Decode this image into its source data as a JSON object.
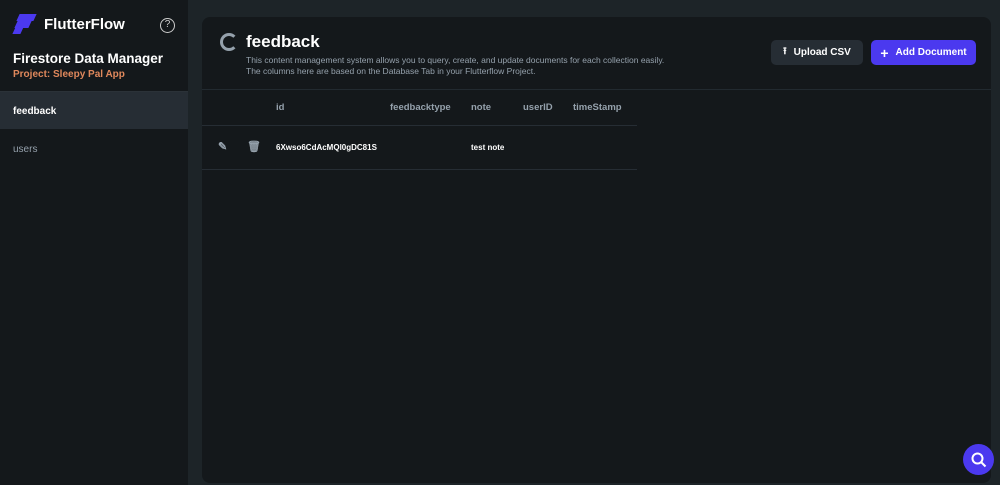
{
  "brand": "FlutterFlow",
  "help_icon": "?",
  "title": "Firestore Data Manager",
  "project": "Project: Sleepy Pal App",
  "collections": [
    {
      "label": "feedback"
    },
    {
      "label": "users"
    }
  ],
  "main": {
    "title": "feedback",
    "description": "This content management system allows you to query, create, and update documents for each collection easily. The columns here are based on the Database Tab in your Flutterflow Project.",
    "upload_label": "Upload CSV",
    "add_label": "Add Document"
  },
  "table": {
    "columns": [
      "id",
      "feedbacktype",
      "note",
      "userID",
      "timeStamp"
    ],
    "rows": [
      {
        "id": "6Xwso6CdAcMQl0gDC81S",
        "feedbacktype": "",
        "note": "test note",
        "userID": "",
        "timeStamp": ""
      }
    ]
  },
  "colors": {
    "accent": "#4b39ef",
    "project": "#e0885c"
  }
}
